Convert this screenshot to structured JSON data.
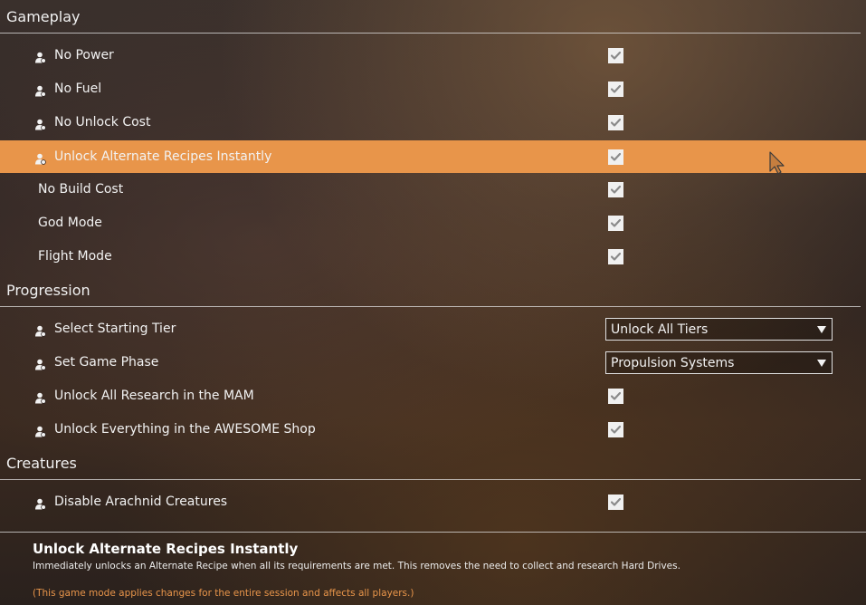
{
  "sections": {
    "gameplay": {
      "title": "Gameplay",
      "rows": [
        {
          "label": "No Power",
          "checked": true
        },
        {
          "label": "No Fuel",
          "checked": true
        },
        {
          "label": "No Unlock Cost",
          "checked": true
        },
        {
          "label": "Unlock Alternate Recipes Instantly",
          "checked": true,
          "highlighted": true
        },
        {
          "label": "No Build Cost",
          "checked": true
        },
        {
          "label": "God Mode",
          "checked": true
        },
        {
          "label": "Flight Mode",
          "checked": true
        }
      ]
    },
    "progression": {
      "title": "Progression",
      "rows": [
        {
          "label": "Select Starting Tier",
          "dropdown_value": "Unlock All Tiers"
        },
        {
          "label": "Set Game Phase",
          "dropdown_value": "Propulsion Systems"
        },
        {
          "label": "Unlock All Research in the MAM",
          "checked": true
        },
        {
          "label": "Unlock Everything in the AWESOME Shop",
          "checked": true
        }
      ]
    },
    "creatures": {
      "title": "Creatures",
      "rows": [
        {
          "label": "Disable Arachnid Creatures",
          "checked": true
        }
      ]
    }
  },
  "footer": {
    "title": "Unlock Alternate Recipes Instantly",
    "description": "Immediately unlocks an Alternate Recipe when all its requirements are met. This removes the need to collect and research Hard Drives.",
    "note": "(This game mode applies changes for the entire session and affects all players.)"
  },
  "colors": {
    "highlight": "#e8954a",
    "note": "#e8954a",
    "checkbox": "#f0f0f0",
    "check_mark": "#8a8a8a"
  },
  "icons": {
    "session_user": "user-icon",
    "checkbox": "checkmark-icon",
    "dropdown": "triangle-down-icon",
    "cursor": "mouse-cursor-icon"
  }
}
